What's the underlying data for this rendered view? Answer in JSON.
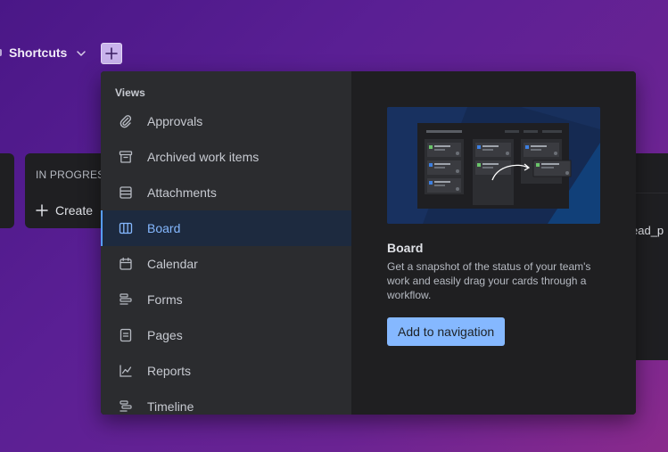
{
  "topbar": {
    "shortcuts_label": "Shortcuts"
  },
  "board": {
    "column_in_progress_title": "IN PROGRESS",
    "create_label": "Create",
    "right_column_text": "ead_p"
  },
  "popup": {
    "section_heading": "Views",
    "items": [
      {
        "label": "Approvals",
        "icon": "paperclip-icon",
        "selected": false
      },
      {
        "label": "Archived work items",
        "icon": "archive-icon",
        "selected": false
      },
      {
        "label": "Attachments",
        "icon": "attachments-icon",
        "selected": false
      },
      {
        "label": "Board",
        "icon": "board-icon",
        "selected": true
      },
      {
        "label": "Calendar",
        "icon": "calendar-icon",
        "selected": false
      },
      {
        "label": "Forms",
        "icon": "forms-icon",
        "selected": false
      },
      {
        "label": "Pages",
        "icon": "pages-icon",
        "selected": false
      },
      {
        "label": "Reports",
        "icon": "reports-icon",
        "selected": false
      },
      {
        "label": "Timeline",
        "icon": "timeline-icon",
        "selected": false
      }
    ],
    "preview": {
      "title": "Board",
      "description": "Get a snapshot of the status of your team's work and easily drag your cards through a workflow.",
      "add_button_label": "Add to navigation"
    }
  },
  "colors": {
    "accent": "#85b8ff",
    "selected_bg": "#1d2a3f",
    "popup_left_bg": "#2b2c2f",
    "popup_right_bg": "#1f1f21"
  }
}
